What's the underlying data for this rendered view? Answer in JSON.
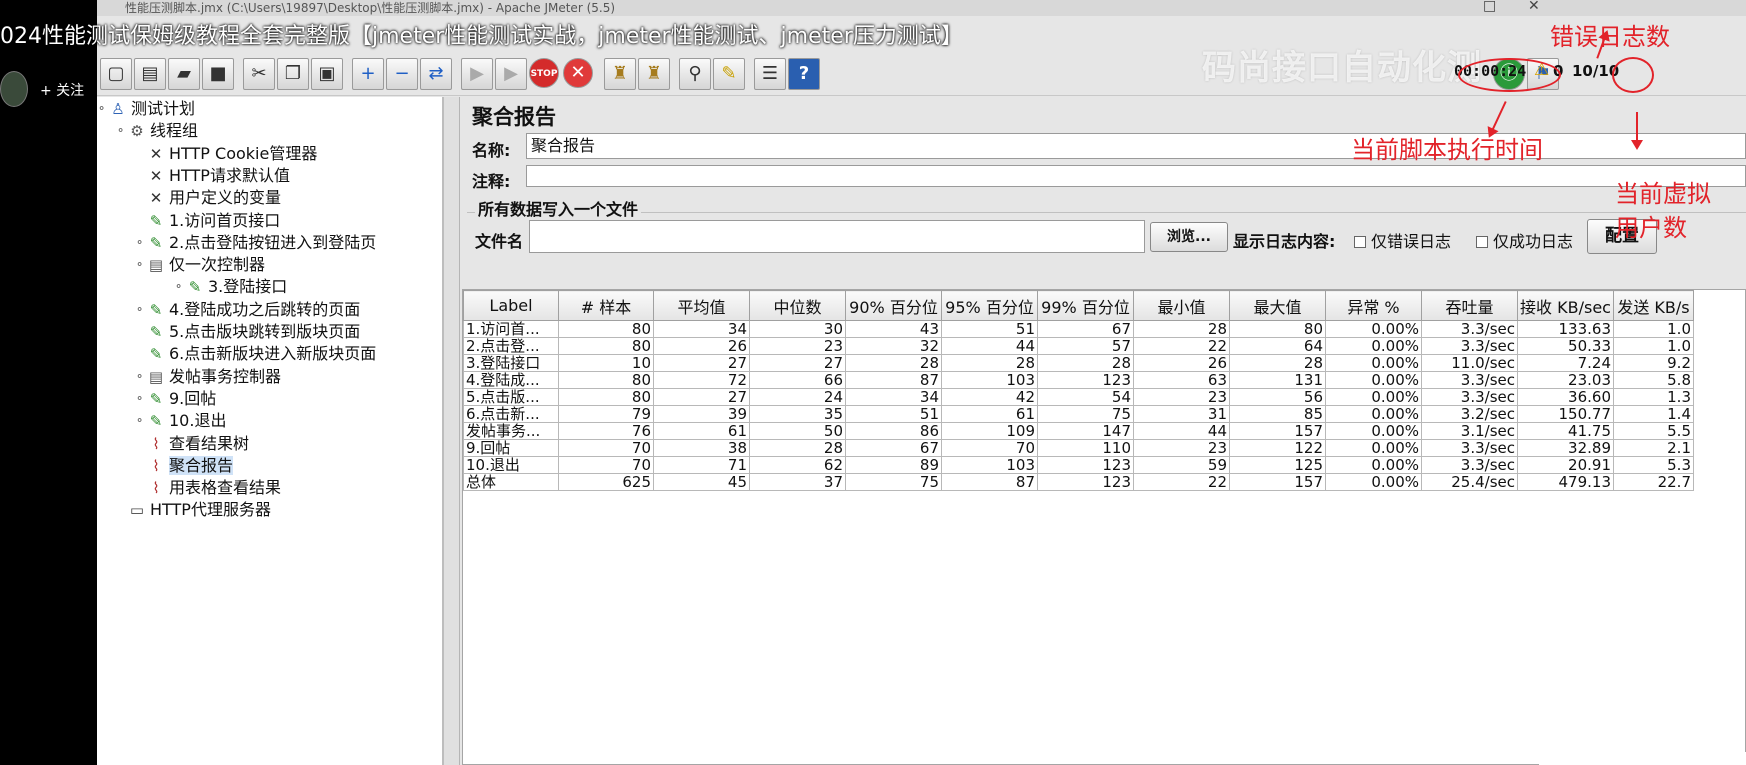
{
  "window": {
    "title": "性能压测脚本.jmx (C:\\Users\\19897\\Desktop\\性能压测脚本.jmx) - Apache JMeter (5.5)"
  },
  "overlay": {
    "video_title": "024性能测试保姆级教程全套完整版【jmeter性能测试实战，jmeter性能测试、jmeter压力测试】",
    "follow_label": "+ 关注",
    "watermark": "码尚接口自动化测",
    "annotations": {
      "error_log_count": "错误日志数",
      "exec_time": "当前脚本执行时间",
      "virtual_users_1": "当前虚拟",
      "virtual_users_2": "用户数"
    },
    "accent_color": "#e2232a"
  },
  "status": {
    "elapsed": "00:00:24",
    "error_count": "0",
    "threads": "10/10"
  },
  "tree": {
    "nodes": [
      {
        "label": "测试计划",
        "icon": "test-plan-icon"
      },
      {
        "label": "线程组",
        "icon": "gear-icon"
      },
      {
        "label": "HTTP Cookie管理器",
        "icon": "wrench-icon"
      },
      {
        "label": "HTTP请求默认值",
        "icon": "wrench-icon"
      },
      {
        "label": "用户定义的变量",
        "icon": "wrench-icon"
      },
      {
        "label": "1.访问首页接口",
        "icon": "pipette-icon"
      },
      {
        "label": "2.点击登陆按钮进入到登陆页",
        "icon": "pipette-icon"
      },
      {
        "label": "仅一次控制器",
        "icon": "controller-icon"
      },
      {
        "label": "3.登陆接口",
        "icon": "pipette-icon"
      },
      {
        "label": "4.登陆成功之后跳转的页面",
        "icon": "pipette-icon"
      },
      {
        "label": "5.点击版块跳转到版块页面",
        "icon": "pipette-icon"
      },
      {
        "label": "6.点击新版块进入新版块页面",
        "icon": "pipette-icon"
      },
      {
        "label": "发帖事务控制器",
        "icon": "controller-icon"
      },
      {
        "label": "9.回帖",
        "icon": "pipette-icon"
      },
      {
        "label": "10.退出",
        "icon": "pipette-icon"
      },
      {
        "label": "查看结果树",
        "icon": "chart-icon"
      },
      {
        "label": "聚合报告",
        "icon": "chart-icon"
      },
      {
        "label": "用表格查看结果",
        "icon": "chart-icon"
      },
      {
        "label": "HTTP代理服务器",
        "icon": "proxy-icon"
      }
    ]
  },
  "panel": {
    "title": "聚合报告",
    "name_label": "名称:",
    "name_value": "聚合报告",
    "comment_label": "注释:",
    "comment_value": "",
    "file_section_title": "所有数据写入一个文件",
    "filename_label": "文件名",
    "filename_value": "",
    "browse_button": "浏览...",
    "log_content_label": "显示日志内容:",
    "only_errors": "仅错误日志",
    "only_success": "仅成功日志",
    "configure_button": "配置"
  },
  "table": {
    "headers": [
      "Label",
      "# 样本",
      "平均值",
      "中位数",
      "90% 百分位",
      "95% 百分位",
      "99% 百分位",
      "最小值",
      "最大值",
      "异常 %",
      "吞吐量",
      "接收 KB/sec",
      "发送 KB/s"
    ],
    "rows": [
      [
        "1.访问首...",
        "80",
        "34",
        "30",
        "43",
        "51",
        "67",
        "28",
        "80",
        "0.00%",
        "3.3/sec",
        "133.63",
        "1.0"
      ],
      [
        "2.点击登...",
        "80",
        "26",
        "23",
        "32",
        "44",
        "57",
        "22",
        "64",
        "0.00%",
        "3.3/sec",
        "50.33",
        "1.0"
      ],
      [
        "3.登陆接口",
        "10",
        "27",
        "27",
        "28",
        "28",
        "28",
        "26",
        "28",
        "0.00%",
        "11.0/sec",
        "7.24",
        "9.2"
      ],
      [
        "4.登陆成...",
        "80",
        "72",
        "66",
        "87",
        "103",
        "123",
        "63",
        "131",
        "0.00%",
        "3.3/sec",
        "23.03",
        "5.8"
      ],
      [
        "5.点击版...",
        "80",
        "27",
        "24",
        "34",
        "42",
        "54",
        "23",
        "56",
        "0.00%",
        "3.3/sec",
        "36.60",
        "1.3"
      ],
      [
        "6.点击新...",
        "79",
        "39",
        "35",
        "51",
        "61",
        "75",
        "31",
        "85",
        "0.00%",
        "3.2/sec",
        "150.77",
        "1.4"
      ],
      [
        "发帖事务...",
        "76",
        "61",
        "50",
        "86",
        "109",
        "147",
        "44",
        "157",
        "0.00%",
        "3.1/sec",
        "41.75",
        "5.5"
      ],
      [
        "9.回帖",
        "70",
        "38",
        "28",
        "67",
        "70",
        "110",
        "23",
        "122",
        "0.00%",
        "3.3/sec",
        "32.89",
        "2.1"
      ],
      [
        "10.退出",
        "70",
        "71",
        "62",
        "89",
        "103",
        "123",
        "59",
        "125",
        "0.00%",
        "3.3/sec",
        "20.91",
        "5.3"
      ],
      [
        "总体",
        "625",
        "45",
        "37",
        "75",
        "87",
        "123",
        "22",
        "157",
        "0.00%",
        "25.4/sec",
        "479.13",
        "22.7"
      ]
    ]
  }
}
